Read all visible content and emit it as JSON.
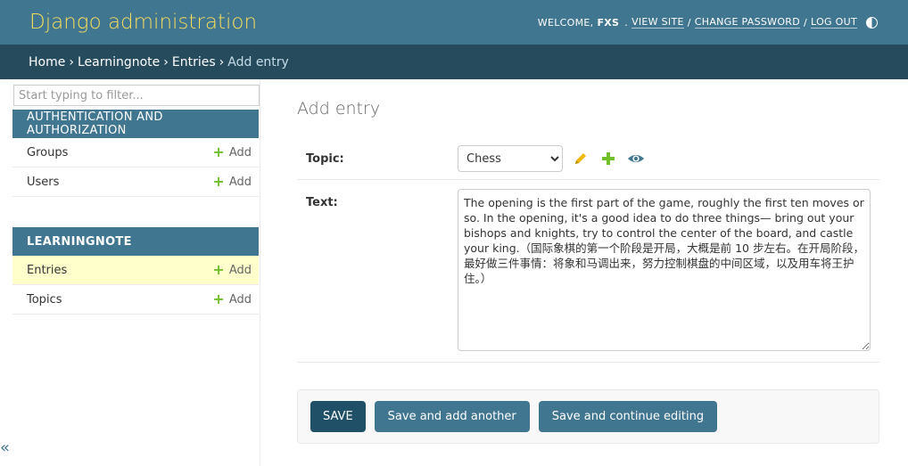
{
  "header": {
    "site_name": "Django administration",
    "welcome": "WELCOME,",
    "username": "FXS",
    "view_site": "VIEW SITE",
    "change_password": "CHANGE PASSWORD",
    "log_out": "LOG OUT",
    "separator": "/"
  },
  "breadcrumbs": {
    "home": "Home",
    "app": "Learningnote",
    "model": "Entries",
    "current": "Add entry",
    "arrow": "›"
  },
  "sidebar": {
    "filter_placeholder": "Start typing to filter...",
    "toggle": "«",
    "apps": [
      {
        "caption": "AUTHENTICATION AND AUTHORIZATION",
        "models": [
          {
            "name": "Groups",
            "add": "Add"
          },
          {
            "name": "Users",
            "add": "Add"
          }
        ]
      },
      {
        "caption": "LEARNINGNOTE",
        "models": [
          {
            "name": "Entries",
            "add": "Add",
            "selected": true
          },
          {
            "name": "Topics",
            "add": "Add"
          }
        ]
      }
    ]
  },
  "content": {
    "title": "Add entry",
    "topic_label": "Topic:",
    "topic_value": "Chess",
    "text_label": "Text:",
    "text_value": "The opening is the first part of the game, roughly the first ten moves or so. In the opening, it's a good idea to do three things— bring out your bishops and knights, try to control the center of the board, and castle your king.（国际象棋的第一个阶段是开局，大概是前 10 步左右。在开局阶段，最好做三件事情：将象和马调出来，努力控制棋盘的中间区域，以及用车将王护住。）",
    "save": "SAVE",
    "save_add_another": "Save and add another",
    "save_continue": "Save and continue editing"
  },
  "colors": {
    "header_bg": "#417690",
    "breadcrumb_bg": "#264b5d",
    "site_name": "#f5dd5d",
    "add_icon": "#70bf2b",
    "edit_icon": "#efb80b",
    "view_icon": "#417690",
    "selected_row": "#ffffcc"
  },
  "icons": {
    "edit": "pencil-icon",
    "add": "plus-icon",
    "view": "eye-icon",
    "theme": "half-circle-icon"
  }
}
